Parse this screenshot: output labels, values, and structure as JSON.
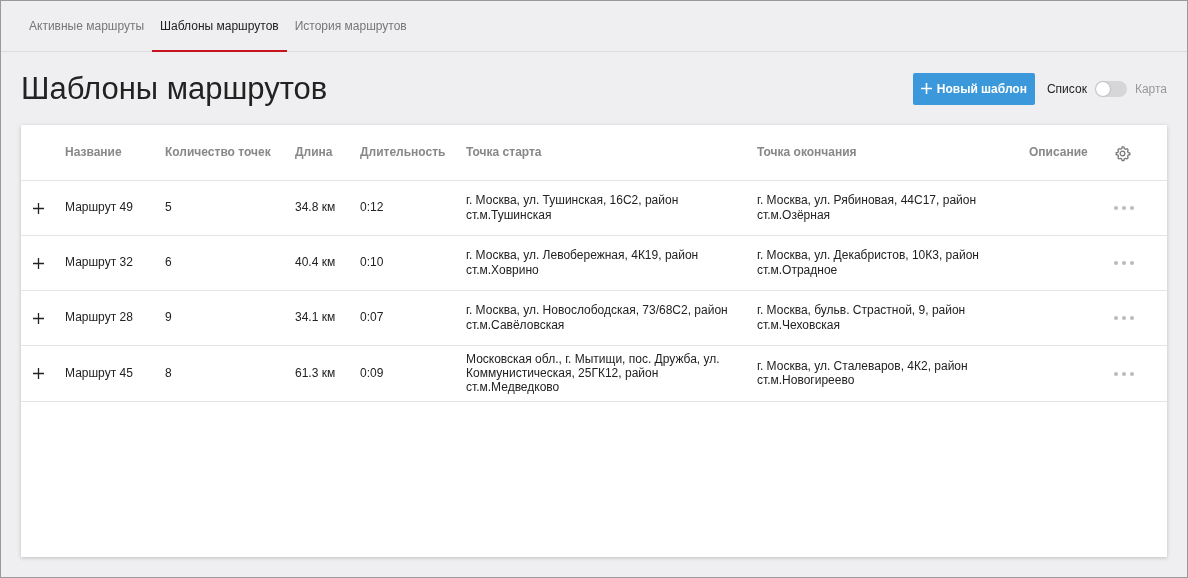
{
  "tabs": [
    {
      "label": "Активные маршруты",
      "selected": false
    },
    {
      "label": "Шаблоны маршрутов",
      "selected": true
    },
    {
      "label": "История маршрутов",
      "selected": false
    }
  ],
  "page_title": "Шаблоны маршрутов",
  "new_button": "Новый шаблон",
  "view_toggle": {
    "left_label": "Список",
    "right_label": "Карта",
    "on": false
  },
  "table": {
    "columns": [
      "Название",
      "Количество точек",
      "Длина",
      "Длительность",
      "Точка старта",
      "Точка окончания",
      "Описание"
    ],
    "rows": [
      {
        "name": "Маршрут 49",
        "points": "5",
        "length": "34.8 км",
        "duration": "0:12",
        "start": "г. Москва, ул. Тушинская, 16С2, район ст.м.Тушинская",
        "end": "г. Москва, ул. Рябиновая, 44С17, район ст.м.Озёрная"
      },
      {
        "name": "Маршрут 32",
        "points": "6",
        "length": "40.4 км",
        "duration": "0:10",
        "start": "г. Москва, ул. Левобережная, 4К19, район ст.м.Ховрино",
        "end": "г. Москва, ул. Декабристов, 10К3, район ст.м.Отрадное"
      },
      {
        "name": "Маршрут 28",
        "points": "9",
        "length": "34.1 км",
        "duration": "0:07",
        "start": "г. Москва, ул. Новослободская, 73/68С2, район ст.м.Савёловская",
        "end": "г. Москва, бульв. Страстной, 9, район ст.м.Чеховская"
      },
      {
        "name": "Маршрут 45",
        "points": "8",
        "length": "61.3 км",
        "duration": "0:09",
        "start": "Московская обл., г. Мытищи, пос. Дружба, ул. Коммунистическая, 25ГК12, район ст.м.Медведково",
        "end": "г. Москва, ул. Сталеваров, 4К2, район ст.м.Новогиреево"
      }
    ]
  }
}
